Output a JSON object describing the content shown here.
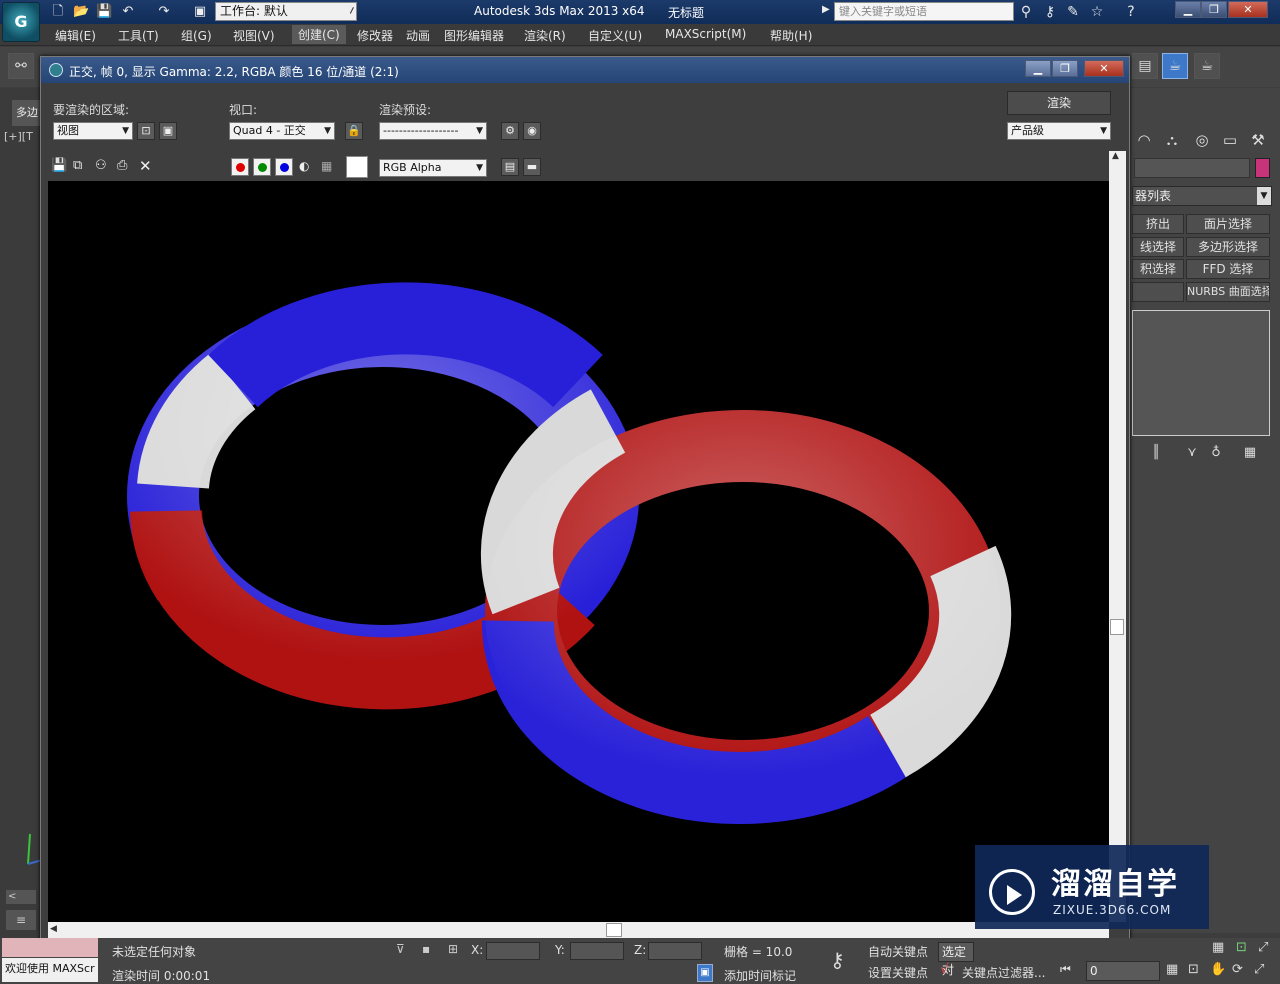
{
  "app": {
    "logo": "G",
    "title": "Autodesk 3ds Max  2013 x64",
    "document": "无标题",
    "workspace": "工作台: 默认",
    "search_placeholder": "键入关键字或短语"
  },
  "menu": [
    "编辑(E)",
    "工具(T)",
    "组(G)",
    "视图(V)",
    "创建(C)",
    "修改器",
    "动画",
    "图形编辑器",
    "渲染(R)",
    "自定义(U)",
    "MAXScript(M)",
    "帮助(H)"
  ],
  "viewport": {
    "tab_label": "多边",
    "label": "[+][T"
  },
  "render_window": {
    "title": "正交, 帧 0, 显示 Gamma: 2.2, RGBA 颜色 16 位/通道 (2:1)",
    "area_label": "要渲染的区域:",
    "area_value": "视图",
    "viewport_label": "视口:",
    "viewport_value": "Quad 4 - 正交",
    "preset_label": "渲染预设:",
    "preset_value": "-------------------",
    "render_button": "渲染",
    "quality_value": "产品级",
    "channel_value": "RGB Alpha"
  },
  "right_panel": {
    "modifier_list": "器列表",
    "buttons": [
      "挤出",
      "面片选择",
      "线选择",
      "多边形选择",
      "积选择",
      "FFD 选择",
      "",
      "NURBS 曲面选择"
    ]
  },
  "status": {
    "welcome": "欢迎使用 MAXScr",
    "selection": "未选定任何对象",
    "render_time": "渲染时间  0:00:01",
    "x_label": "X:",
    "y_label": "Y:",
    "z_label": "Z:",
    "grid": "栅格 = 10.0",
    "add_time_tag": "添加时间标记",
    "auto_key": "自动关键点",
    "set_key": "设置关键点",
    "selected_object": "选定对",
    "key_filters": "关键点过滤器...",
    "frame": "0"
  },
  "watermark": {
    "main": "溜溜自学",
    "url": "ZIXUE.3D66.COM"
  },
  "colors": {
    "torus_blue": "#2a22d8",
    "torus_red": "#b01010",
    "torus_white": "#d8d8d8",
    "accent": "#3e78c8"
  }
}
